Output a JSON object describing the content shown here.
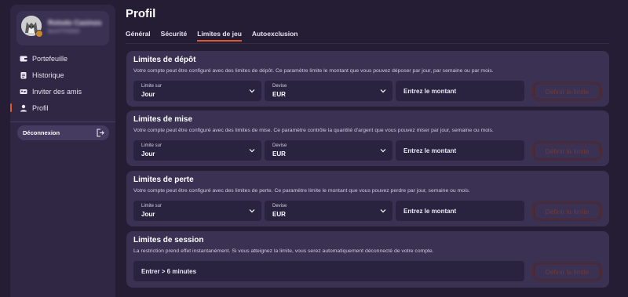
{
  "sidebar": {
    "user": {
      "name": "Rolodo Casinos",
      "sub": "8ex5TFEB92"
    },
    "items": [
      {
        "label": "Portefeuille",
        "icon": "wallet-icon"
      },
      {
        "label": "Historique",
        "icon": "clipboard-icon"
      },
      {
        "label": "Inviter des amis",
        "icon": "invite-card-icon"
      },
      {
        "label": "Profil",
        "icon": "user-icon",
        "active": true
      }
    ],
    "logout": {
      "label": "Déconnexion",
      "icon": "logout-icon"
    }
  },
  "page": {
    "title": "Profil"
  },
  "tabs": [
    {
      "label": "Général"
    },
    {
      "label": "Sécurité"
    },
    {
      "label": "Limites de jeu",
      "active": true
    },
    {
      "label": "Autoexclusion"
    }
  ],
  "cards": {
    "deposit": {
      "title": "Limites de dépôt",
      "description": "Votre compte peut être configuré avec des limites de dépôt. Ce paramètre limite le montant que vous pouvez déposer par jour, par semaine ou par mois.",
      "period_label": "Limite sur",
      "period_value": "Jour",
      "currency_label": "Devise",
      "currency_value": "EUR",
      "amount_placeholder": "Entrez le montant",
      "button": "Définir la limite"
    },
    "bet": {
      "title": "Limites de mise",
      "description": "Votre compte peut être configuré avec des limites de mise. Ce paramètre contrôle la quantité d'argent que vous pouvez miser par jour, semaine ou mois.",
      "period_label": "Limite sur",
      "period_value": "Jour",
      "currency_label": "Devise",
      "currency_value": "EUR",
      "amount_placeholder": "Entrez le montant",
      "button": "Définir la limite"
    },
    "loss": {
      "title": "Limites de perte",
      "description": "Votre compte peut être configuré avec des limites de perte. Ce paramètre limite le montant que vous pouvez perdre par jour, semaine ou mois.",
      "period_label": "Limite sur",
      "period_value": "Jour",
      "currency_label": "Devise",
      "currency_value": "EUR",
      "amount_placeholder": "Entrez le montant",
      "button": "Définir la limite"
    },
    "session": {
      "title": "Limites de session",
      "description": "La restriction prend effet instantanément. Si vous atteignez la limite, vous serez automatiquement déconnecté de votre compte.",
      "minutes_placeholder": "Entrer > 6 minutes",
      "button": "Définir la limite"
    }
  },
  "colors": {
    "accent": "#e3572d",
    "card": "#3a3153",
    "field": "#2a2340",
    "background": "#241d33"
  }
}
